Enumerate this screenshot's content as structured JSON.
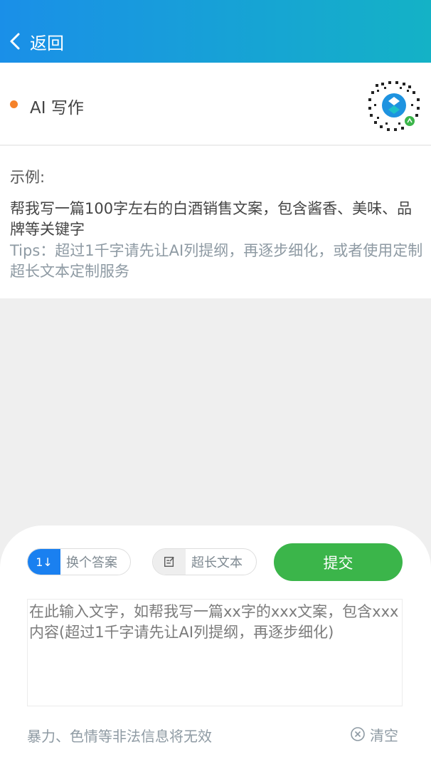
{
  "header": {
    "back_label": "返回",
    "back_icon": "chevron-left-icon",
    "gradient_start": "#1a8fe8",
    "gradient_end": "#14b2c6"
  },
  "title_bar": {
    "title": "AI 写作",
    "dot_color": "#f5822a",
    "qr_icon": "mini-program-qr-code"
  },
  "example": {
    "label": "示例:",
    "body": "帮我写一篇100字左右的白酒销售文案，包含酱香、美味、品牌等关键字",
    "tips": "Tips：超过1千字请先让AI列提纲，再逐步细化，或者使用定制超长文本定制服务"
  },
  "controls": {
    "switch_icon_text": "1↓",
    "switch_label": "换个答案",
    "long_text_icon": "edit-note-icon",
    "long_text_label": "超长文本",
    "submit_label": "提交",
    "submit_color": "#3bb54a",
    "switch_color": "#1a80f0"
  },
  "input": {
    "placeholder": "在此输入文字，如帮我写一篇xx字的xxx文案，包含xxx内容(超过1千字请先让AI列提纲，再逐步细化)",
    "value": ""
  },
  "footer": {
    "warning": "暴力、色情等非法信息将无效",
    "clear_label": "清空",
    "clear_icon": "circle-x-icon"
  }
}
